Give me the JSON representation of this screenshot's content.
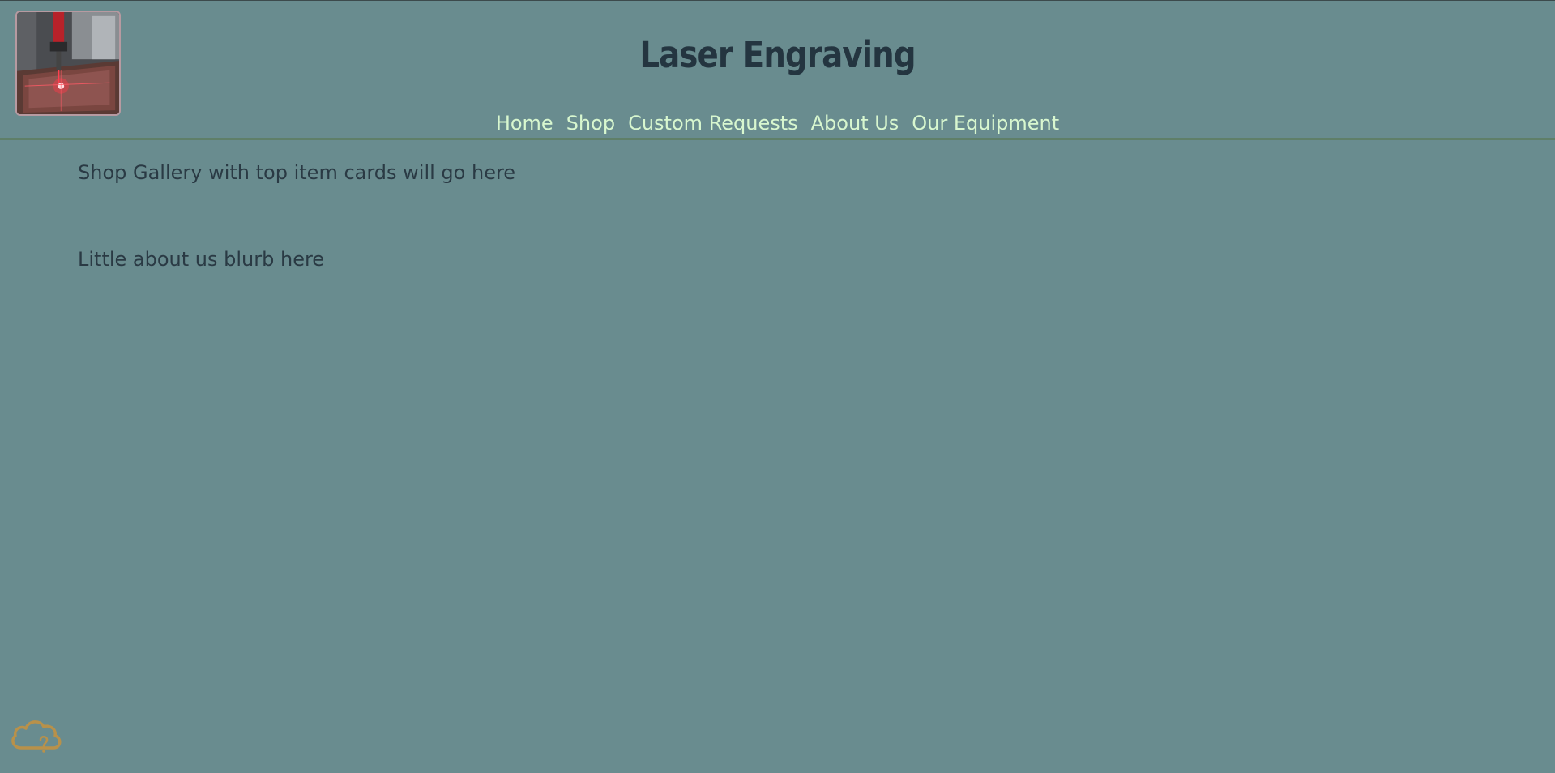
{
  "header": {
    "title": "Laser Engraving",
    "logo_icon": "laser-engraver-photo"
  },
  "nav": {
    "items": [
      {
        "label": "Home"
      },
      {
        "label": "Shop"
      },
      {
        "label": "Custom Requests"
      },
      {
        "label": "About Us"
      },
      {
        "label": "Our Equipment"
      }
    ]
  },
  "main": {
    "gallery_placeholder": "Shop Gallery with top item cards will go here",
    "about_placeholder": "Little about us blurb here"
  },
  "widget": {
    "icon": "cloud-question-icon"
  },
  "colors": {
    "background": "#698c8f",
    "nav_link": "#d8f7cf",
    "title": "#243540",
    "text": "#2a3a44",
    "header_border": "#5f7f68",
    "cloud_icon": "#b8914a"
  }
}
